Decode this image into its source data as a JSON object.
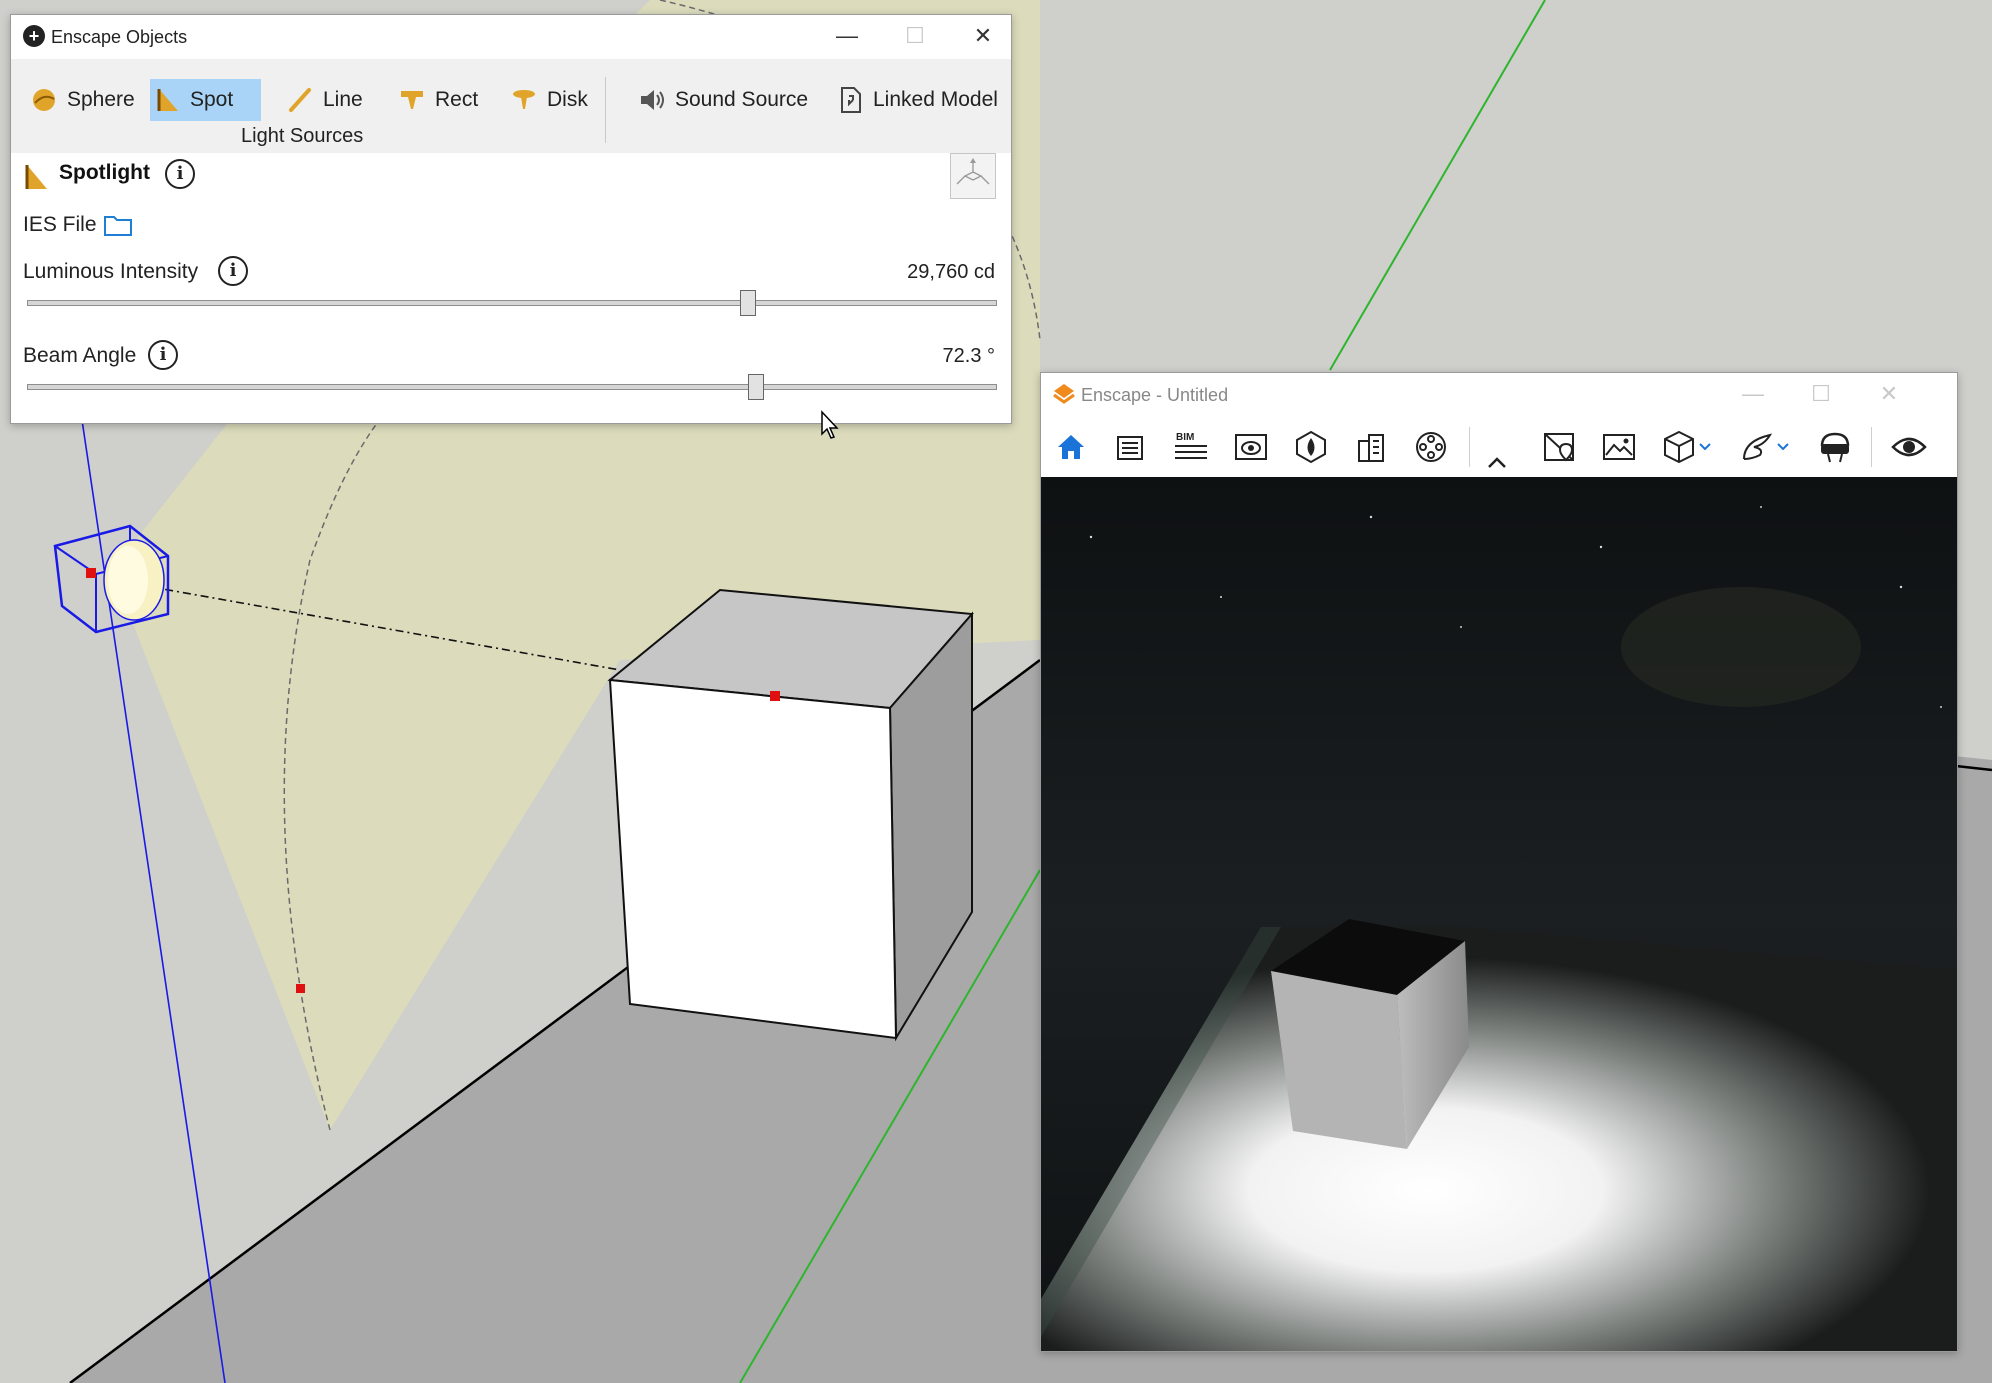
{
  "colors": {
    "active_tab": "#a9d4f7",
    "light_gold": "#e0a42a",
    "link_blue": "#1f7fd4",
    "enscape_orange": "#f08a1c",
    "enscape_home_blue": "#1a73d8",
    "selection_blue": "#1a1ae6",
    "axis_green": "#2db52d"
  },
  "objects_window": {
    "title": "Enscape Objects",
    "controls": {
      "minimize": "—",
      "maximize": "☐",
      "close": "✕"
    },
    "toolbar": {
      "light_sources": [
        {
          "label": "Sphere",
          "icon": "sphere-light-icon"
        },
        {
          "label": "Spot",
          "icon": "spot-light-icon",
          "active": true
        },
        {
          "label": "Line",
          "icon": "line-light-icon"
        },
        {
          "label": "Rect",
          "icon": "rect-light-icon"
        },
        {
          "label": "Disk",
          "icon": "disk-light-icon"
        }
      ],
      "group_label": "Light Sources",
      "other": [
        {
          "label": "Sound Source",
          "icon": "speaker-icon"
        },
        {
          "label": "Linked Model",
          "icon": "linked-model-icon"
        }
      ]
    },
    "properties": {
      "title": "Spotlight",
      "ies_label": "IES File",
      "luminous_label": "Luminous Intensity",
      "luminous_value": "29,760 cd",
      "luminous_level": 0.745,
      "beam_label": "Beam Angle",
      "beam_value": "72.3 °",
      "beam_level": 0.753
    }
  },
  "enscape_window": {
    "title": "Enscape - Untitled",
    "controls": {
      "minimize": "—",
      "maximize": "☐",
      "close": "✕"
    },
    "toolbar_icons": [
      "home-icon",
      "settings-list-icon",
      "bim-icon",
      "view-management-icon",
      "atmosphere-icon",
      "asset-library-icon",
      "video-reel-icon",
      "collapse-chevron-icon",
      "map-location-icon",
      "render-image-icon",
      "export-cube-icon",
      "export-wing-icon",
      "vr-headset-icon",
      "visibility-eye-icon"
    ],
    "bim_label": "BIM"
  }
}
